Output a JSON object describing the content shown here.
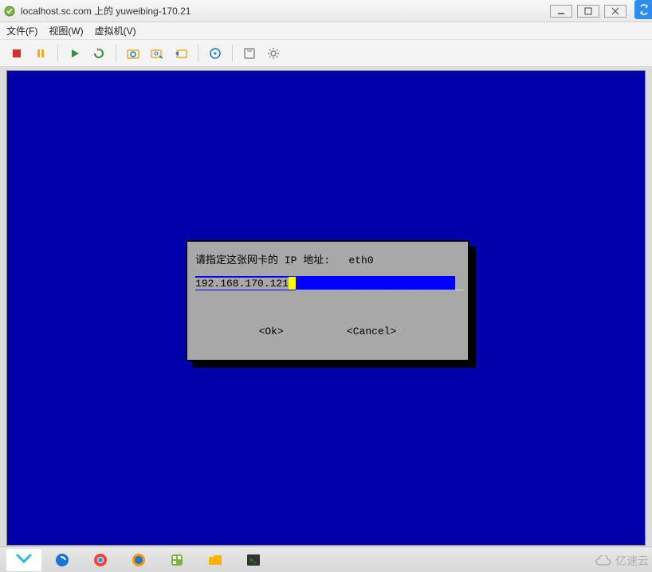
{
  "titlebar": {
    "title": "localhost.sc.com 上的 yuweibing-170.21"
  },
  "menu": {
    "file": "文件(F)",
    "view": "视图(W)",
    "vm": "虚拟机(V)"
  },
  "toolbar": {
    "icons": {
      "stop": "stop",
      "pause": "pause",
      "play": "play",
      "reset": "reset",
      "snapshot": "snapshot",
      "snapshot_mgr": "snapshot-manager",
      "revert": "revert",
      "settings": "settings",
      "cd": "cd-drive",
      "floppy": "floppy"
    }
  },
  "dialog": {
    "prompt": "请指定这张网卡的 IP 地址:   eth0",
    "input_value": "192.168.170.121",
    "ok_label": "<Ok>",
    "cancel_label": "<Cancel>"
  },
  "watermark": {
    "text": "亿速云"
  }
}
